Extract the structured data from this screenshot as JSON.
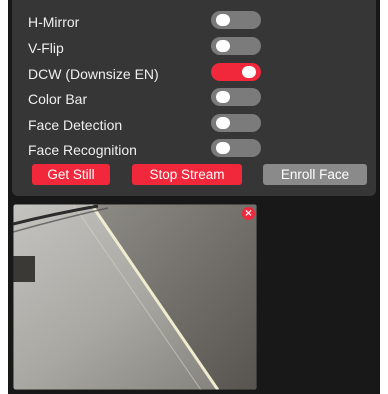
{
  "settings": {
    "h_mirror": {
      "label": "H-Mirror",
      "on": false
    },
    "v_flip": {
      "label": "V-Flip",
      "on": false
    },
    "dcw": {
      "label": "DCW (Downsize EN)",
      "on": true
    },
    "color_bar": {
      "label": "Color Bar",
      "on": false
    },
    "face_detection": {
      "label": "Face Detection",
      "on": false
    },
    "face_recognition": {
      "label": "Face Recognition",
      "on": false
    }
  },
  "buttons": {
    "get_still": "Get Still",
    "stop_stream": "Stop Stream",
    "enroll_face": "Enroll Face"
  },
  "stream": {
    "close_icon": "close-icon",
    "close_glyph": "×"
  },
  "colors": {
    "accent": "#f1283b",
    "panel": "#363636",
    "background": "#181818",
    "toggle_off": "#7b7b7b",
    "button_disabled": "#8a8a8a"
  }
}
